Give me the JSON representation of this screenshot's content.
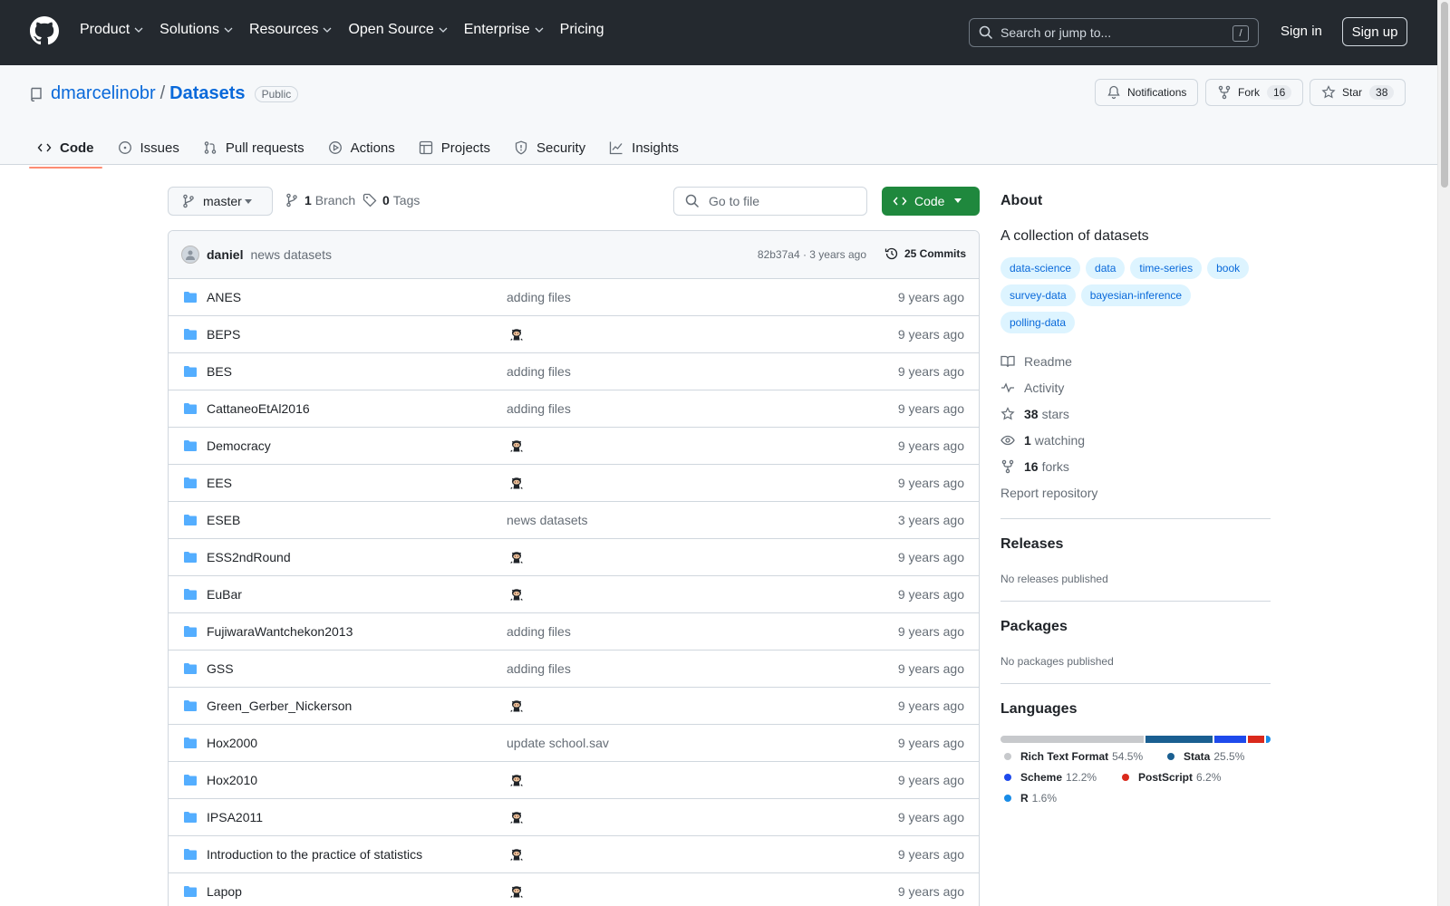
{
  "header": {
    "nav": [
      "Product",
      "Solutions",
      "Resources",
      "Open Source",
      "Enterprise",
      "Pricing"
    ],
    "search_placeholder": "Search or jump to...",
    "search_shortcut": "/",
    "signin": "Sign in",
    "signup": "Sign up"
  },
  "repo": {
    "owner": "dmarcelinobr",
    "separator": "/",
    "name": "Datasets",
    "visibility": "Public",
    "notifications_label": "Notifications",
    "fork_label": "Fork",
    "fork_count": "16",
    "star_label": "Star",
    "star_count": "38"
  },
  "tabs": [
    "Code",
    "Issues",
    "Pull requests",
    "Actions",
    "Projects",
    "Security",
    "Insights"
  ],
  "toolbar": {
    "branch": "master",
    "branch_count": "1",
    "branch_label": "Branch",
    "tag_count": "0",
    "tag_label": "Tags",
    "goto_placeholder": "Go to file",
    "code_button": "Code"
  },
  "commit": {
    "author": "daniel",
    "message": "news datasets",
    "hash_time": "82b37a4 · 3 years ago",
    "commits": "25 Commits"
  },
  "files": [
    {
      "name": "ANES",
      "message": "adding files",
      "age": "9 years ago",
      "octocat": false
    },
    {
      "name": "BEPS",
      "message": "",
      "age": "9 years ago",
      "octocat": true
    },
    {
      "name": "BES",
      "message": "adding files",
      "age": "9 years ago",
      "octocat": false
    },
    {
      "name": "CattaneoEtAl2016",
      "message": "adding files",
      "age": "9 years ago",
      "octocat": false
    },
    {
      "name": "Democracy",
      "message": "",
      "age": "9 years ago",
      "octocat": true
    },
    {
      "name": "EES",
      "message": "",
      "age": "9 years ago",
      "octocat": true
    },
    {
      "name": "ESEB",
      "message": "news datasets",
      "age": "3 years ago",
      "octocat": false
    },
    {
      "name": "ESS2ndRound",
      "message": "",
      "age": "9 years ago",
      "octocat": true
    },
    {
      "name": "EuBar",
      "message": "",
      "age": "9 years ago",
      "octocat": true
    },
    {
      "name": "FujiwaraWantchekon2013",
      "message": "adding files",
      "age": "9 years ago",
      "octocat": false
    },
    {
      "name": "GSS",
      "message": "adding files",
      "age": "9 years ago",
      "octocat": false
    },
    {
      "name": "Green_Gerber_Nickerson",
      "message": "",
      "age": "9 years ago",
      "octocat": true
    },
    {
      "name": "Hox2000",
      "message": "update school.sav",
      "age": "9 years ago",
      "octocat": false
    },
    {
      "name": "Hox2010",
      "message": "",
      "age": "9 years ago",
      "octocat": true
    },
    {
      "name": "IPSA2011",
      "message": "",
      "age": "9 years ago",
      "octocat": true
    },
    {
      "name": "Introduction to the practice of statistics",
      "message": "",
      "age": "9 years ago",
      "octocat": true
    },
    {
      "name": "Lapop",
      "message": "",
      "age": "9 years ago",
      "octocat": true
    }
  ],
  "sidebar": {
    "about_title": "About",
    "description": "A collection of datasets",
    "topics": [
      "data-science",
      "data",
      "time-series",
      "book",
      "survey-data",
      "bayesian-inference",
      "polling-data"
    ],
    "readme": "Readme",
    "activity": "Activity",
    "stars_count": "38",
    "stars_label": "stars",
    "watching_count": "1",
    "watching_label": "watching",
    "forks_count": "16",
    "forks_label": "forks",
    "report": "Report repository",
    "releases_title": "Releases",
    "releases_text": "No releases published",
    "packages_title": "Packages",
    "packages_text": "No packages published",
    "languages_title": "Languages",
    "languages": [
      {
        "name": "Rich Text Format",
        "pct": "54.5%",
        "share": 54.5,
        "color": "#c7c9cc"
      },
      {
        "name": "Stata",
        "pct": "25.5%",
        "share": 25.5,
        "color": "#1a5f91"
      },
      {
        "name": "Scheme",
        "pct": "12.2%",
        "share": 12.2,
        "color": "#1e4aec"
      },
      {
        "name": "PostScript",
        "pct": "6.2%",
        "share": 6.2,
        "color": "#da291c"
      },
      {
        "name": "R",
        "pct": "1.6%",
        "share": 1.6,
        "color": "#198ce7"
      }
    ]
  },
  "colors": {
    "accent": "#0969da",
    "header_bg": "#24292f",
    "code_button": "#1f883d",
    "tab_underline": "#fd8c73",
    "topic_bg": "#ddf4ff"
  }
}
